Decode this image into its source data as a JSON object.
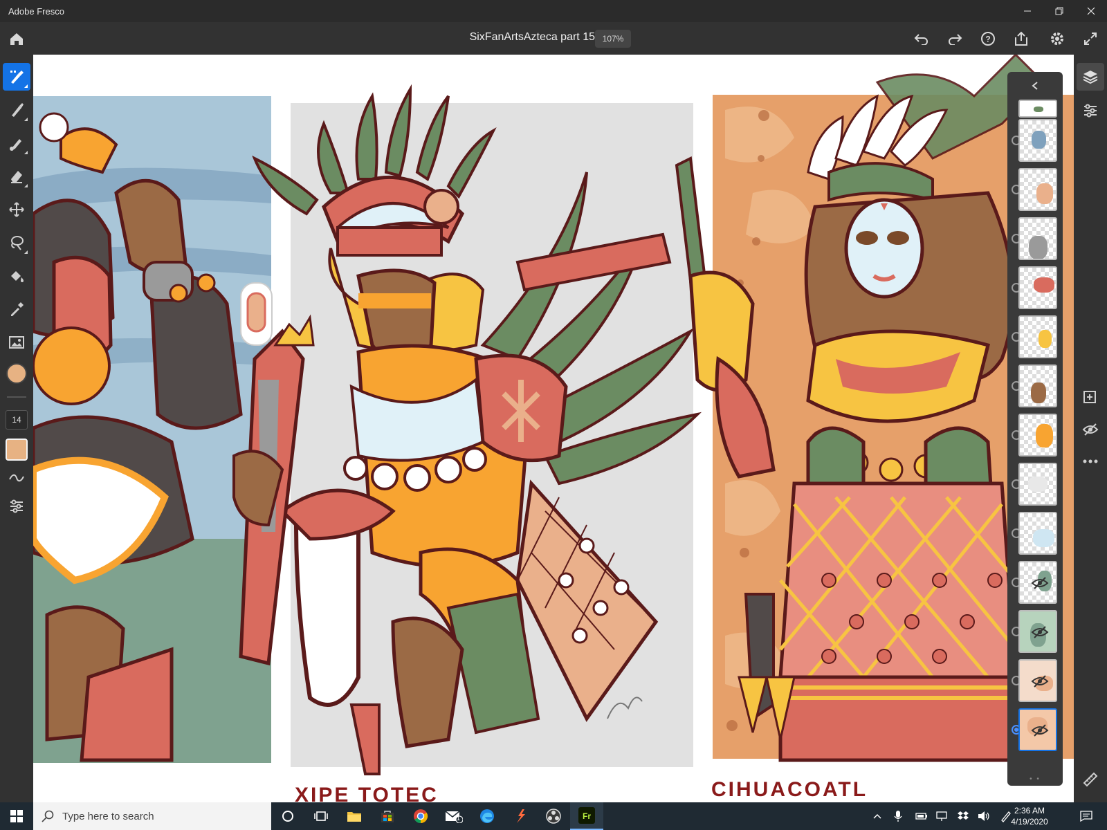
{
  "window": {
    "title": "Adobe Fresco",
    "minimize": "—",
    "restore": "❐",
    "close": "✕"
  },
  "header": {
    "document_name": "SixFanArtsAzteca part 15",
    "zoom": "107%"
  },
  "toolbar": {
    "brush_size": "14",
    "color": "#e7b283",
    "accent": "#1473e6"
  },
  "canvas": {
    "caption_left": "XIPE TOTEC",
    "caption_right": "CIHUACOATL"
  },
  "layers": {
    "pager": "• •",
    "items": [
      {
        "id": "layer-top",
        "visible": true
      },
      {
        "id": "layer-2",
        "visible": true
      },
      {
        "id": "layer-3",
        "visible": true
      },
      {
        "id": "layer-4",
        "visible": true
      },
      {
        "id": "layer-5",
        "visible": true
      },
      {
        "id": "layer-6",
        "visible": true
      },
      {
        "id": "layer-7",
        "visible": true
      },
      {
        "id": "layer-8",
        "visible": true
      },
      {
        "id": "layer-9",
        "visible": true
      },
      {
        "id": "layer-10",
        "visible": true
      },
      {
        "id": "layer-11",
        "visible": false
      },
      {
        "id": "layer-12",
        "visible": false
      },
      {
        "id": "layer-13",
        "visible": false
      },
      {
        "id": "layer-14",
        "visible": false,
        "selected": true
      }
    ]
  },
  "taskbar": {
    "search_placeholder": "Type here to search",
    "mail_badge": "1",
    "time": "2:36 AM",
    "date": "4/19/2020"
  }
}
